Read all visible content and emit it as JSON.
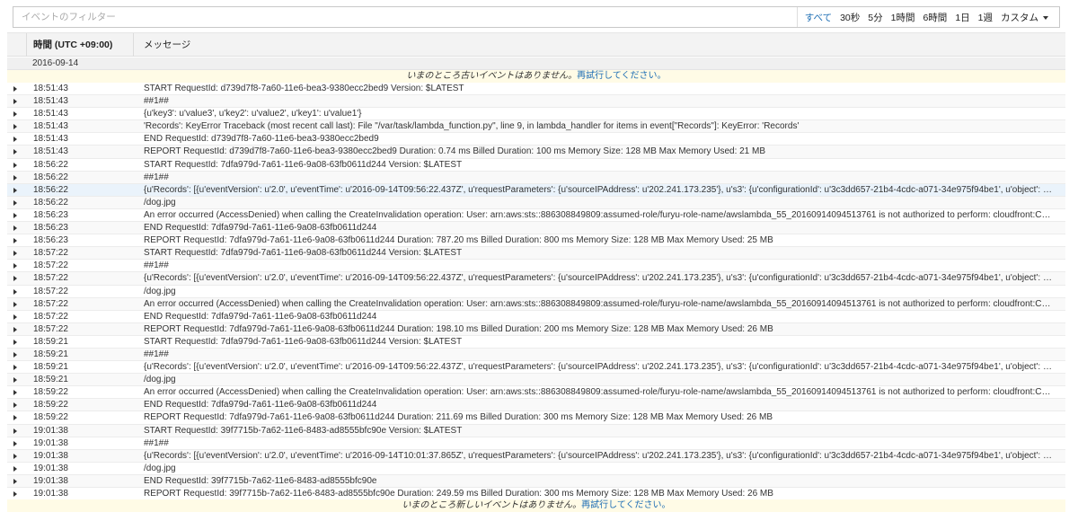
{
  "filter": {
    "placeholder": "イベントのフィルター",
    "value": ""
  },
  "time_range": {
    "options": [
      "すべて",
      "30秒",
      "5分",
      "1時間",
      "6時間",
      "1日",
      "1週",
      "カスタム"
    ],
    "active": "すべて"
  },
  "columns": {
    "time": "時間 (UTC +09:00)",
    "message": "メッセージ"
  },
  "date": "2016-09-14",
  "notice_top": {
    "text": "いまのところ古いイベントはありません。",
    "retry": "再試行してください。"
  },
  "notice_bottom": {
    "text": "いまのところ新しいイベントはありません。",
    "retry": "再試行してください。"
  },
  "rows": [
    {
      "time": "18:51:43",
      "msg": "START RequestId: d739d7f8-7a60-11e6-bea3-9380ecc2bed9 Version: $LATEST"
    },
    {
      "time": "18:51:43",
      "msg": "##1##"
    },
    {
      "time": "18:51:43",
      "msg": "{u'key3': u'value3', u'key2': u'value2', u'key1': u'value1'}"
    },
    {
      "time": "18:51:43",
      "msg": "'Records': KeyError Traceback (most recent call last): File \"/var/task/lambda_function.py\", line 9, in lambda_handler for items in event[\"Records\"]: KeyError: 'Records'"
    },
    {
      "time": "18:51:43",
      "msg": "END RequestId: d739d7f8-7a60-11e6-bea3-9380ecc2bed9"
    },
    {
      "time": "18:51:43",
      "msg": "REPORT RequestId: d739d7f8-7a60-11e6-bea3-9380ecc2bed9 Duration: 0.74 ms Billed Duration: 100 ms Memory Size: 128 MB Max Memory Used: 21 MB"
    },
    {
      "time": "18:56:22",
      "msg": "START RequestId: 7dfa979d-7a61-11e6-9a08-63fb0611d244 Version: $LATEST"
    },
    {
      "time": "18:56:22",
      "msg": "##1##"
    },
    {
      "time": "18:56:22",
      "msg": "{u'Records': [{u'eventVersion': u'2.0', u'eventTime': u'2016-09-14T09:56:22.437Z', u'requestParameters': {u'sourceIPAddress': u'202.241.173.235'}, u's3': {u'configurationId': u'3c3dd657-21b4-4cdc-a071-34e975f94be1', u'object': {u'eTag'"
    },
    {
      "time": "18:56:22",
      "msg": "/dog.jpg"
    },
    {
      "time": "18:56:23",
      "msg": "An error occurred (AccessDenied) when calling the CreateInvalidation operation: User: arn:aws:sts::886308849809:assumed-role/furyu-role-name/awslambda_55_20160914094513761 is not authorized to perform: cloudfront:CreateInvalidation"
    },
    {
      "time": "18:56:23",
      "msg": "END RequestId: 7dfa979d-7a61-11e6-9a08-63fb0611d244"
    },
    {
      "time": "18:56:23",
      "msg": "REPORT RequestId: 7dfa979d-7a61-11e6-9a08-63fb0611d244 Duration: 787.20 ms Billed Duration: 800 ms Memory Size: 128 MB Max Memory Used: 25 MB"
    },
    {
      "time": "18:57:22",
      "msg": "START RequestId: 7dfa979d-7a61-11e6-9a08-63fb0611d244 Version: $LATEST"
    },
    {
      "time": "18:57:22",
      "msg": "##1##"
    },
    {
      "time": "18:57:22",
      "msg": "{u'Records': [{u'eventVersion': u'2.0', u'eventTime': u'2016-09-14T09:56:22.437Z', u'requestParameters': {u'sourceIPAddress': u'202.241.173.235'}, u's3': {u'configurationId': u'3c3dd657-21b4-4cdc-a071-34e975f94be1', u'object': {u'eTag'"
    },
    {
      "time": "18:57:22",
      "msg": "/dog.jpg"
    },
    {
      "time": "18:57:22",
      "msg": "An error occurred (AccessDenied) when calling the CreateInvalidation operation: User: arn:aws:sts::886308849809:assumed-role/furyu-role-name/awslambda_55_20160914094513761 is not authorized to perform: cloudfront:CreateInvalidation"
    },
    {
      "time": "18:57:22",
      "msg": "END RequestId: 7dfa979d-7a61-11e6-9a08-63fb0611d244"
    },
    {
      "time": "18:57:22",
      "msg": "REPORT RequestId: 7dfa979d-7a61-11e6-9a08-63fb0611d244 Duration: 198.10 ms Billed Duration: 200 ms Memory Size: 128 MB Max Memory Used: 26 MB"
    },
    {
      "time": "18:59:21",
      "msg": "START RequestId: 7dfa979d-7a61-11e6-9a08-63fb0611d244 Version: $LATEST"
    },
    {
      "time": "18:59:21",
      "msg": "##1##"
    },
    {
      "time": "18:59:21",
      "msg": "{u'Records': [{u'eventVersion': u'2.0', u'eventTime': u'2016-09-14T09:56:22.437Z', u'requestParameters': {u'sourceIPAddress': u'202.241.173.235'}, u's3': {u'configurationId': u'3c3dd657-21b4-4cdc-a071-34e975f94be1', u'object': {u'eTag'"
    },
    {
      "time": "18:59:21",
      "msg": "/dog.jpg"
    },
    {
      "time": "18:59:22",
      "msg": "An error occurred (AccessDenied) when calling the CreateInvalidation operation: User: arn:aws:sts::886308849809:assumed-role/furyu-role-name/awslambda_55_20160914094513761 is not authorized to perform: cloudfront:CreateInvalidation"
    },
    {
      "time": "18:59:22",
      "msg": "END RequestId: 7dfa979d-7a61-11e6-9a08-63fb0611d244"
    },
    {
      "time": "18:59:22",
      "msg": "REPORT RequestId: 7dfa979d-7a61-11e6-9a08-63fb0611d244 Duration: 211.69 ms Billed Duration: 300 ms Memory Size: 128 MB Max Memory Used: 26 MB"
    },
    {
      "time": "19:01:38",
      "msg": "START RequestId: 39f7715b-7a62-11e6-8483-ad8555bfc90e Version: $LATEST"
    },
    {
      "time": "19:01:38",
      "msg": "##1##"
    },
    {
      "time": "19:01:38",
      "msg": "{u'Records': [{u'eventVersion': u'2.0', u'eventTime': u'2016-09-14T10:01:37.865Z', u'requestParameters': {u'sourceIPAddress': u'202.241.173.235'}, u's3': {u'configurationId': u'3c3dd657-21b4-4cdc-a071-34e975f94be1', u'object': {u'eTag'"
    },
    {
      "time": "19:01:38",
      "msg": "/dog.jpg"
    },
    {
      "time": "19:01:38",
      "msg": "END RequestId: 39f7715b-7a62-11e6-8483-ad8555bfc90e"
    },
    {
      "time": "19:01:38",
      "msg": "REPORT RequestId: 39f7715b-7a62-11e6-8483-ad8555bfc90e Duration: 249.59 ms Billed Duration: 300 ms Memory Size: 128 MB Max Memory Used: 26 MB"
    }
  ]
}
